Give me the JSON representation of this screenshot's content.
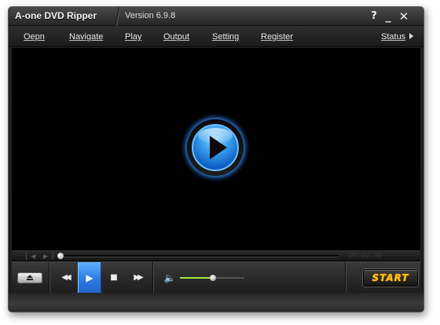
{
  "window": {
    "title": "A-one DVD Ripper",
    "version": "Version 6.9.8",
    "controls": {
      "help": "?",
      "minimize": "_",
      "close": "✕"
    }
  },
  "menu": [
    {
      "label": "Oepn"
    },
    {
      "label": "Navigate"
    },
    {
      "label": "Play"
    },
    {
      "label": "Output"
    },
    {
      "label": "Setting"
    },
    {
      "label": "Register"
    }
  ],
  "status_menu": {
    "label": "Status"
  },
  "seekbar": {
    "time": "00:00:00",
    "prev_icon": "▏◀",
    "next_icon": "▶▕",
    "progress": 0.0
  },
  "controls": {
    "rewind_icon": "◀◀",
    "play_icon": "▶",
    "stop_icon": "■",
    "forward_icon": "▶▶",
    "speaker_icon": "🔈",
    "volume": 0.5,
    "start_label": "START"
  },
  "colors": {
    "accent_blue": "#2f7fe5",
    "start_text": "#ffc21a",
    "volume_fill": "#a9e53f"
  }
}
